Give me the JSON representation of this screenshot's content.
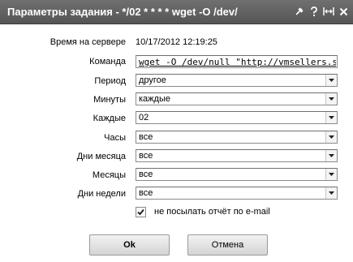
{
  "window": {
    "title": "Параметры задания - */02 * * * * wget -O /dev/",
    "icons": [
      "pin-icon",
      "help-icon",
      "maximize-icon",
      "close-icon"
    ]
  },
  "form": {
    "server_time_label": "Время на сервере",
    "server_time_value": "10/17/2012 12:19:25",
    "command_label": "Команда",
    "command_value": "wget -O /dev/null \"http://vmsellers.sitogon.r",
    "period_label": "Период",
    "period_value": "другое",
    "minutes_label": "Минуты",
    "minutes_value": "каждые",
    "every_label": "Каждые",
    "every_value": "02",
    "hours_label": "Часы",
    "hours_value": "все",
    "days_of_month_label": "Дни месяца",
    "days_of_month_value": "все",
    "months_label": "Месяцы",
    "months_value": "все",
    "days_of_week_label": "Дни недели",
    "days_of_week_value": "все",
    "no_email_label": "не посылать отчёт по e-mail",
    "no_email_checked": true
  },
  "buttons": {
    "ok_label": "Ok",
    "cancel_label": "Отмена"
  }
}
